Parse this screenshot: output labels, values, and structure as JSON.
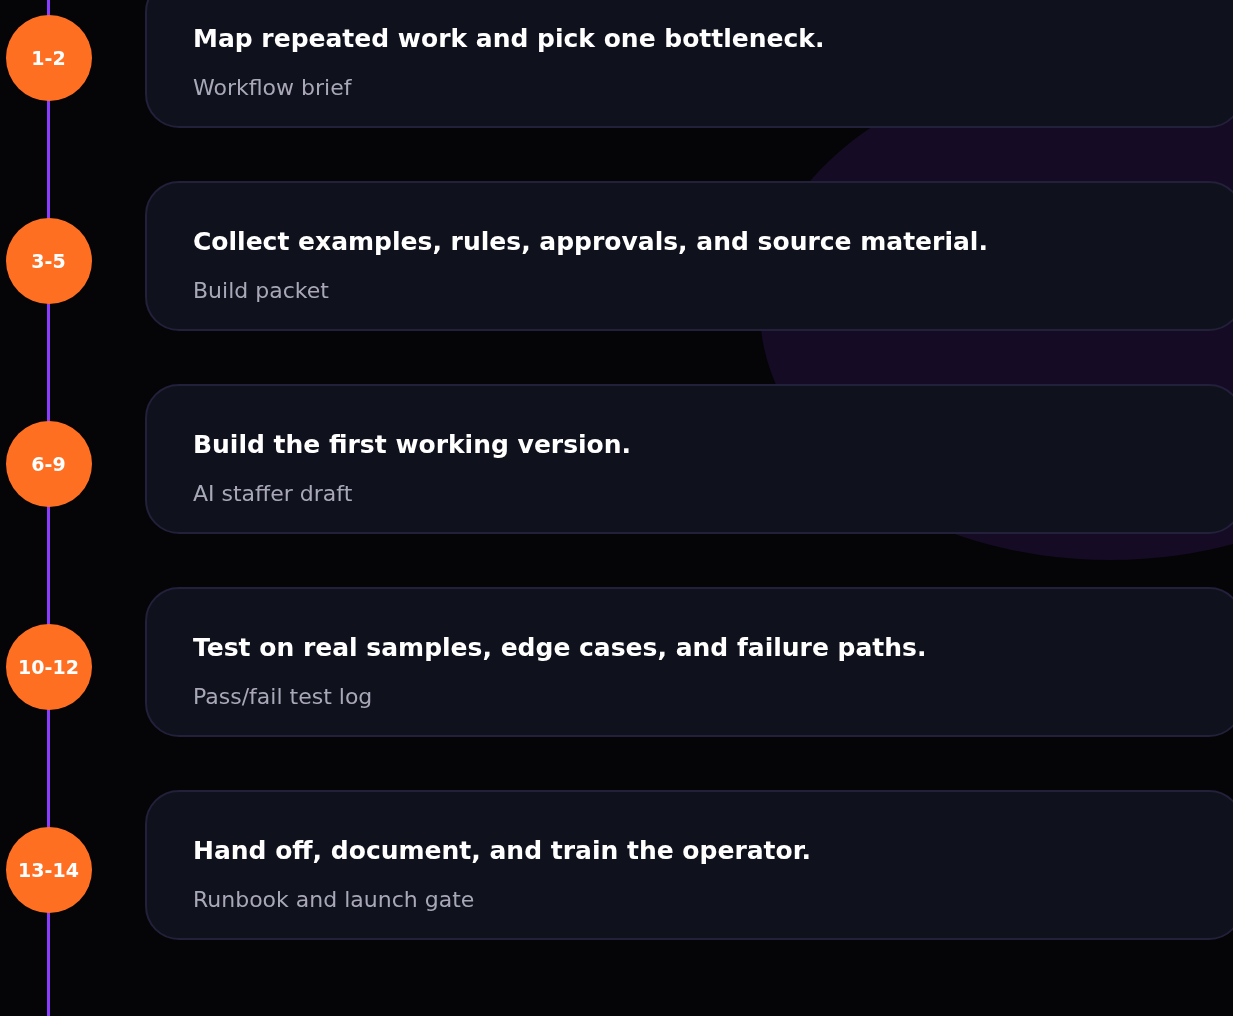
{
  "steps": [
    {
      "range": "1-2",
      "title": "Map repeated work and pick one bottleneck.",
      "deliverable": "Workflow brief"
    },
    {
      "range": "3-5",
      "title": "Collect examples, rules, approvals, and source material.",
      "deliverable": "Build packet"
    },
    {
      "range": "6-9",
      "title": "Build the first working version.",
      "deliverable": "AI staffer draft"
    },
    {
      "range": "10-12",
      "title": "Test on real samples, edge cases, and failure paths.",
      "deliverable": "Pass/fail test log"
    },
    {
      "range": "13-14",
      "title": "Hand off, document, and train the operator.",
      "deliverable": "Runbook and launch gate"
    }
  ]
}
